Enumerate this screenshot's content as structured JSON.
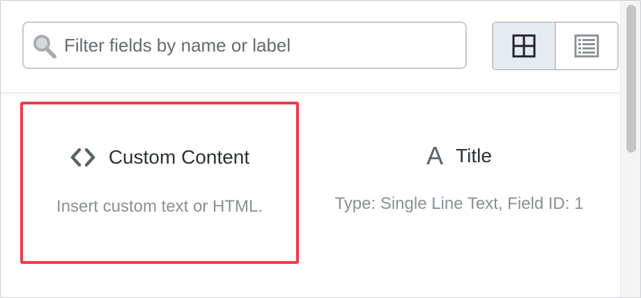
{
  "search": {
    "placeholder": "Filter fields by name or label",
    "value": ""
  },
  "view_toggle": {
    "options": [
      {
        "name": "grid-view",
        "icon": "grid-icon",
        "active": true
      },
      {
        "name": "list-view",
        "icon": "list-icon",
        "active": false
      }
    ]
  },
  "fields": [
    {
      "title": "Custom Content",
      "icon": "code-brackets-icon",
      "description": "Insert custom text or HTML.",
      "selected": true
    },
    {
      "title": "Title",
      "icon": "text-a-icon",
      "icon_glyph": "A",
      "description": "Type: Single Line Text, Field ID: 1",
      "selected": false
    }
  ],
  "colors": {
    "selection_border": "#ee3b4a",
    "active_toggle_bg": "#e6ebf0",
    "icon_gray": "#5a6168",
    "description_gray": "#8a8f95"
  }
}
